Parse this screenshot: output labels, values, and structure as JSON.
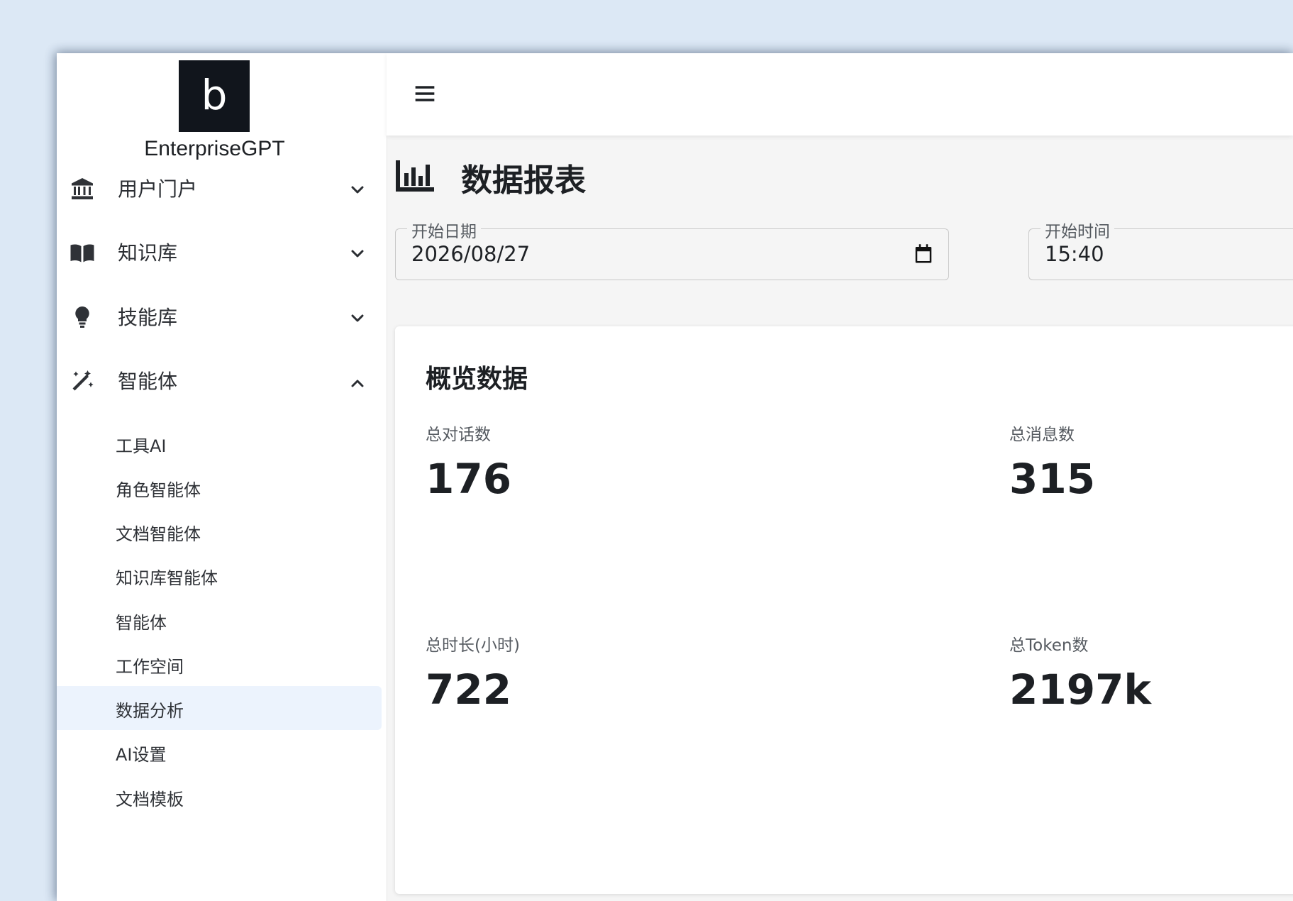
{
  "app": {
    "logo_letter": "b",
    "brand": "EnterpriseGPT"
  },
  "sidebar": {
    "items": [
      {
        "label": "用户门户",
        "icon": "bank-icon",
        "expanded": false
      },
      {
        "label": "知识库",
        "icon": "book-icon",
        "expanded": false
      },
      {
        "label": "技能库",
        "icon": "lightbulb-icon",
        "expanded": false
      },
      {
        "label": "智能体",
        "icon": "magic-wand-icon",
        "expanded": true
      }
    ],
    "sub_items": [
      {
        "label": "工具AI"
      },
      {
        "label": "角色智能体"
      },
      {
        "label": "文档智能体"
      },
      {
        "label": "知识库智能体"
      },
      {
        "label": "智能体"
      },
      {
        "label": "工作空间"
      },
      {
        "label": "数据分析",
        "active": true
      },
      {
        "label": "AI设置"
      },
      {
        "label": "文档模板"
      }
    ]
  },
  "header": {
    "menu_icon": "hamburger-icon"
  },
  "page": {
    "title": "数据报表",
    "title_icon": "bar-chart-icon"
  },
  "filters": {
    "start_date_label": "开始日期",
    "start_date_value": "2026/08/27",
    "start_time_label": "开始时间",
    "start_time_value": "15:40"
  },
  "overview": {
    "title": "概览数据",
    "stats": [
      {
        "label": "总对话数",
        "value": "176"
      },
      {
        "label": "总消息数",
        "value": "315"
      },
      {
        "label": "总时长(小时)",
        "value": "722"
      },
      {
        "label": "总Token数",
        "value": "2197k"
      }
    ]
  }
}
